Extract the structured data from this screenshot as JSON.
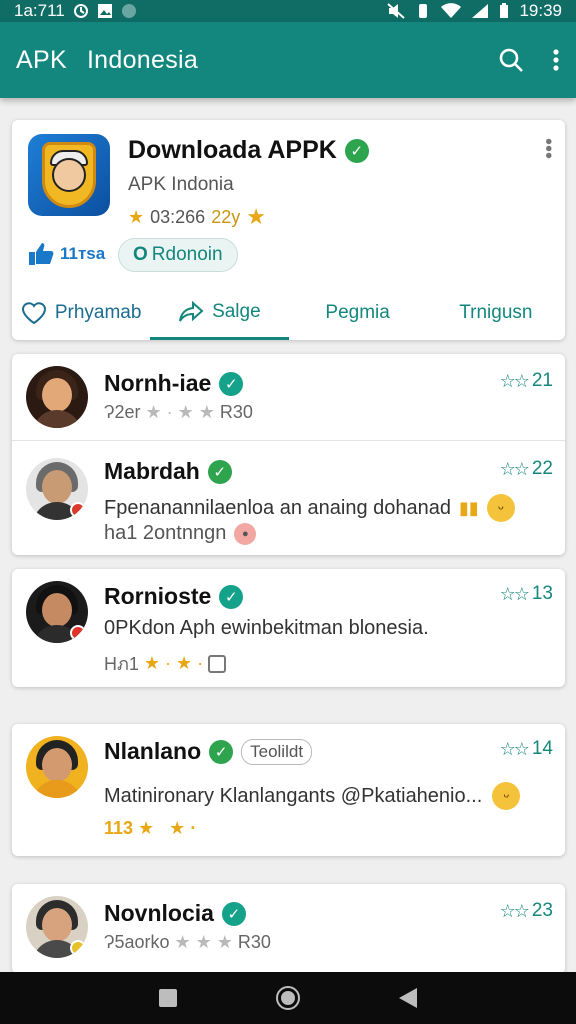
{
  "status_bar": {
    "time_left": "1a:711",
    "time_right": "19:39"
  },
  "appbar": {
    "title_part1": "APK",
    "title_part2": "Indonesia"
  },
  "app": {
    "name": "Downloada APPK",
    "subtitle": "APK Indonia",
    "rating_text": "03:266",
    "rating_year": "22y",
    "likes": "11тsa",
    "chip_label": "Rdonoin",
    "chip_prefix": "O"
  },
  "tabs": [
    {
      "label": "Prhyamab",
      "icon": "heart-icon"
    },
    {
      "label": "Salge",
      "icon": "share-icon"
    },
    {
      "label": "Pegmia"
    },
    {
      "label": "Trnigusn"
    }
  ],
  "reviews": [
    {
      "name": "Nornh-iae",
      "meta": "Ɂ2er",
      "meta_end": "R30",
      "count": "21"
    },
    {
      "name": "Mabrdah",
      "text_line1": "Fpenanannilaenloa an anaing dohanad",
      "text_line2": "ha1 2ontnngn",
      "count": "22"
    },
    {
      "name": "Rornioste",
      "text_line1": "0PKdon Aph ewinbekitman blonesia.",
      "meta": "Hภ1",
      "count": "13"
    },
    {
      "name": "Nlanlano",
      "tag": "Teolildt",
      "text_line1": "Matinironary Klanlangants @Pkatiahenio...",
      "meta": "113",
      "count": "14"
    },
    {
      "name": "Novnlocia",
      "meta": "Ɂ5aorko",
      "meta_end": "R30",
      "count": "23"
    }
  ],
  "colors": {
    "primary": "#13877d",
    "status": "#0f6d66",
    "verified": "#2ea44f",
    "gold": "#e8a714"
  }
}
